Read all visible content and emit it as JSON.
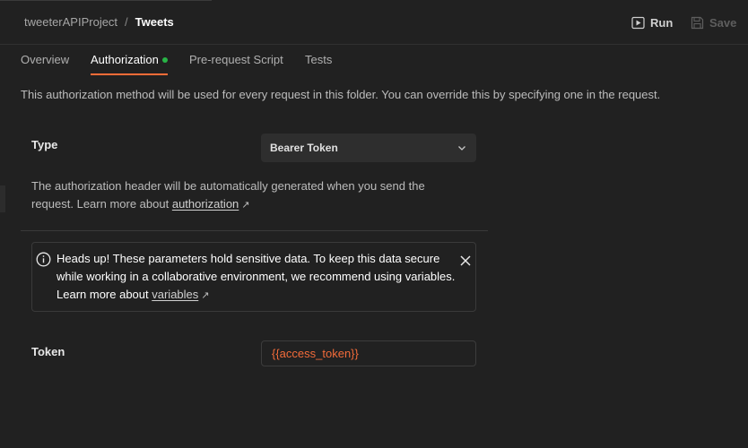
{
  "header": {
    "project": "tweeterAPIProject",
    "separator": "/",
    "current": "Tweets",
    "run_label": "Run",
    "save_label": "Save"
  },
  "tabs": [
    {
      "label": "Overview"
    },
    {
      "label": "Authorization",
      "active": true,
      "status_dot": true
    },
    {
      "label": "Pre-request Script"
    },
    {
      "label": "Tests"
    }
  ],
  "intro": "This authorization method will be used for every request in this folder. You can override this by specifying one in the request.",
  "auth": {
    "type_label": "Type",
    "type_value": "Bearer Token",
    "description_prefix": "The authorization header will be automatically generated when you send the request. Learn more about",
    "description_link": "authorization",
    "arrow": "↗"
  },
  "alert": {
    "text": "Heads up! These parameters hold sensitive data. To keep this data secure while working in a collaborative environment, we recommend using variables. Learn more about",
    "link": "variables",
    "arrow": "↗"
  },
  "token": {
    "label": "Token",
    "value": "{{access_token}}"
  },
  "colors": {
    "accent": "#ff6c37",
    "status_dot": "#28b446",
    "variable": "#f26b3a",
    "background": "#212121"
  },
  "icons": {
    "run": "play-icon",
    "save": "save-icon",
    "dropdown": "chevron-down-icon",
    "info": "info-icon",
    "close": "close-icon"
  }
}
